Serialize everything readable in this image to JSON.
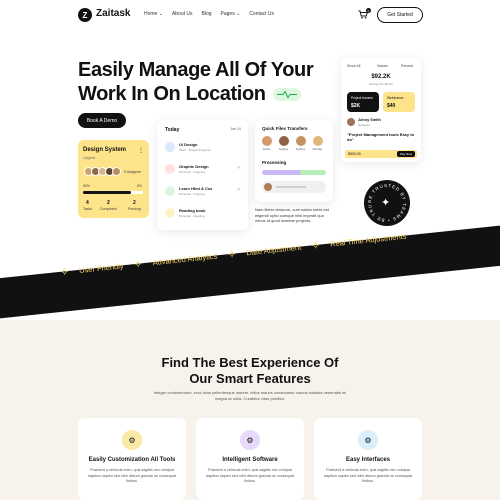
{
  "brand": {
    "name": "Zaitask",
    "logo_glyph": "Z"
  },
  "nav": {
    "items": [
      "Home",
      "About Us",
      "Blog",
      "Pages",
      "Contact Us"
    ],
    "cart_count": "0",
    "cta_label": "Get Started"
  },
  "hero": {
    "title_line1": "Easily Manage All Of Your",
    "title_line2": "Work In On Location",
    "book_demo_label": "Book A Demo",
    "description": "Nam libero tempore, cum soluta nobis est eligendi optio cumque nihil impedit quo minus id quod maxime projects."
  },
  "design_card": {
    "title": "Design System",
    "status": "Urgent",
    "members_label": "5 Assignee",
    "progress_label": "80%",
    "progress_pct_label": "8%",
    "progress_value": 0.8,
    "stats": [
      {
        "value": "4",
        "label": "Tasks"
      },
      {
        "value": "2",
        "label": "Completed"
      },
      {
        "value": "2",
        "label": "Pending"
      }
    ]
  },
  "today_card": {
    "title": "Today",
    "date": "Jan 24",
    "tasks": [
      {
        "name": "UI Design",
        "sub": "Work · Project Progress",
        "icon_color": "#dbe8ff"
      },
      {
        "name": "Graphic Design",
        "sub": "Personal · Ongoing",
        "icon_color": "#ffe1e1"
      },
      {
        "name": "Learn Html & Css",
        "sub": "Personal · Ongoing",
        "icon_color": "#dcf5e3"
      },
      {
        "name": "Reading book",
        "sub": "Personal · Reading",
        "icon_color": "#fff1c7"
      }
    ]
  },
  "transfer_card": {
    "title": "Quick Files Transfers",
    "people": [
      "Jamie",
      "Sydney",
      "Sydney",
      "Monday"
    ],
    "processing_label": "Processing"
  },
  "balance_card": {
    "tabs": [
      "Show All",
      "Values",
      "Percent"
    ],
    "amount": "$92.2K",
    "amount_sub": "Saving Per Month",
    "chip1_label": "Project Income",
    "chip1_value": "$2K",
    "chip2_label": "Webinance",
    "chip2_value": "$40",
    "person_name": "Johny Smith",
    "person_role": "Designer",
    "quote": "\"Project Management tools Easy to do\"",
    "footer_amount": "$500,00",
    "footer_btn": "Pay Now"
  },
  "badge": {
    "ring_text": "BE TRUSTED BY TEAMS",
    "glyph": "✦"
  },
  "ribbon": [
    "User Friendly",
    "Advanced Analytics",
    "Date Adjustment",
    "Real Time Adjustments"
  ],
  "features": {
    "title_line1": "Find The Best Experience Of",
    "title_line2": "Our Smart Features",
    "subtitle": "Integer condimentum, eros vitae pellentesque laoreet, tellus mauris consectetur mauris sodales venenatis mi magna at nulla. Curabitur vitae porttitor.",
    "cards": [
      {
        "title": "Easily Customization All Tools",
        "desc": "Praesent a vehicula enim, quis sagittis nec volutpat dapibus sapien sed nibh dictum gravida ne consequat finibus.",
        "icon_bg": "#fde9a6",
        "icon": "⚙"
      },
      {
        "title": "Intelligent Software",
        "desc": "Praesent a vehicula enim, quis sagittis nec volutpat dapibus sapien sed nibh dictum gravida ne consequat finibus.",
        "icon_bg": "#e6d9fc",
        "icon": "⚙"
      },
      {
        "title": "Easy Interfaces",
        "desc": "Praesent a vehicula enim, quis sagittis nec volutpat dapibus sapien sed nibh dictum gravida ne consequat finibus.",
        "icon_bg": "#d8effc",
        "icon": "⚙"
      }
    ]
  }
}
